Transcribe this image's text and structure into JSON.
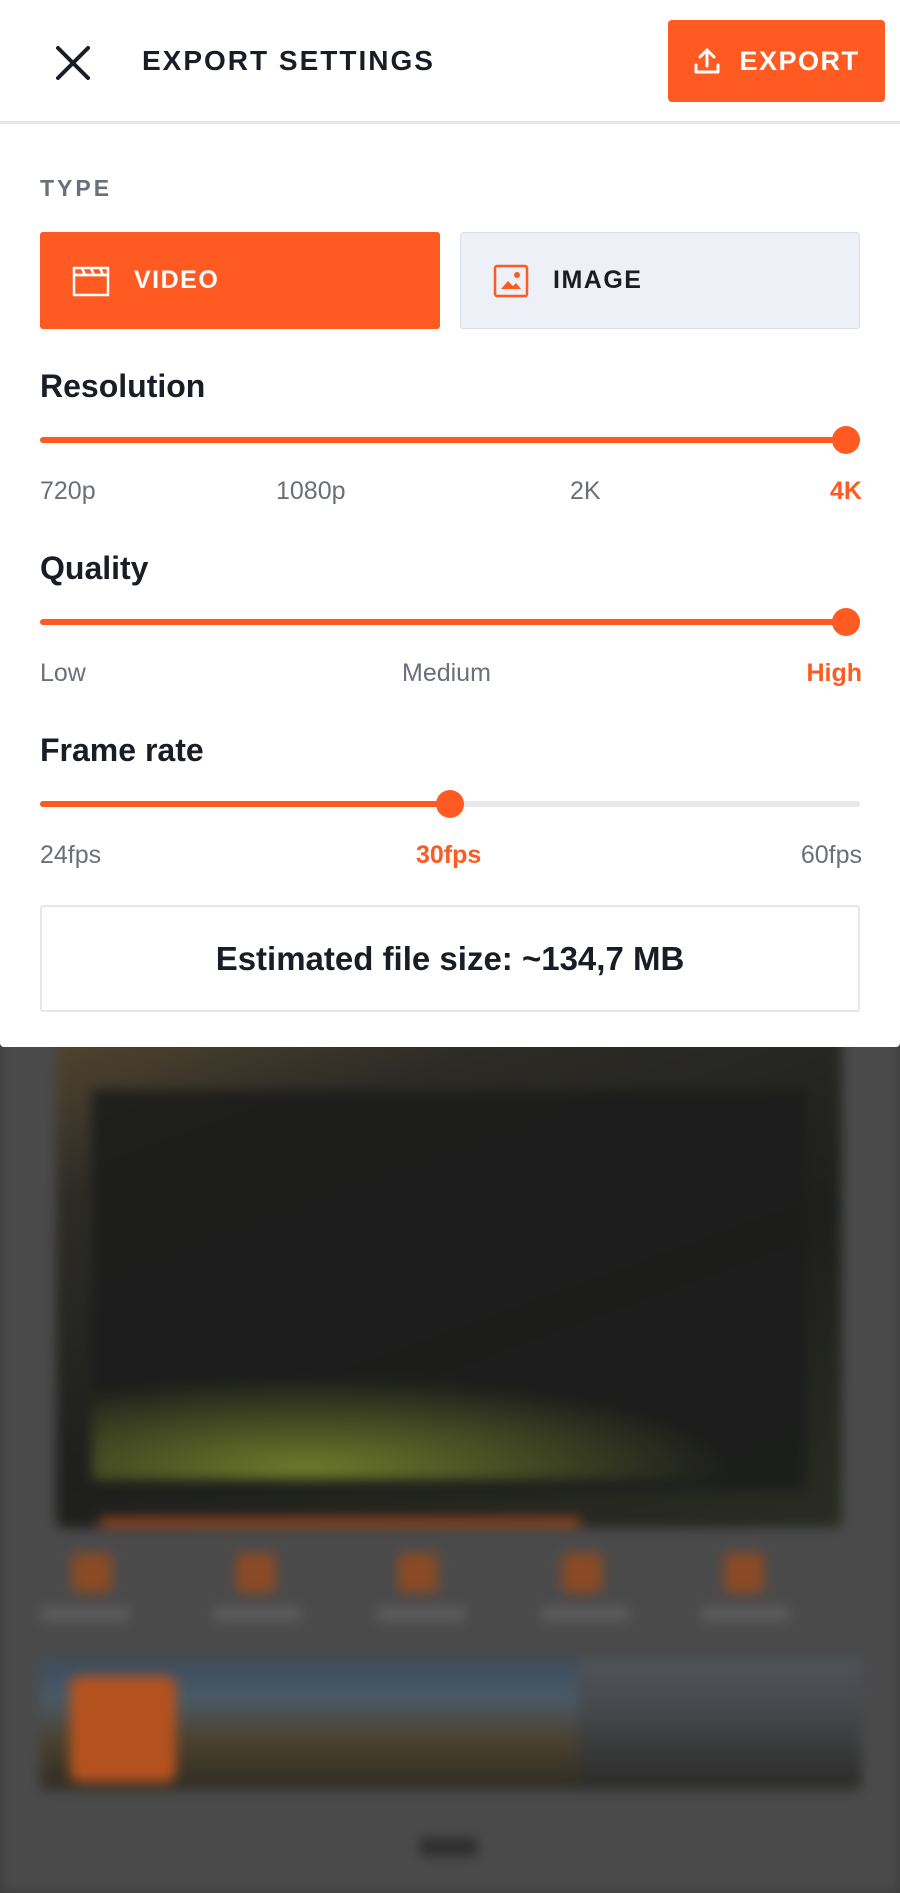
{
  "header": {
    "title": "EXPORT SETTINGS",
    "export_label": "EXPORT"
  },
  "type_section": {
    "label": "TYPE",
    "options": [
      {
        "label": "VIDEO",
        "icon": "clapperboard-icon",
        "selected": true
      },
      {
        "label": "IMAGE",
        "icon": "image-icon",
        "selected": false
      }
    ]
  },
  "resolution": {
    "title": "Resolution",
    "options": [
      "720p",
      "1080p",
      "2K",
      "4K"
    ],
    "selected": "4K",
    "value_fraction": 1.0
  },
  "quality": {
    "title": "Quality",
    "options": [
      "Low",
      "Medium",
      "High"
    ],
    "selected": "High",
    "value_fraction": 1.0
  },
  "frame_rate": {
    "title": "Frame rate",
    "options": [
      "24fps",
      "30fps",
      "60fps"
    ],
    "selected": "30fps",
    "value_fraction": 0.5
  },
  "estimate": {
    "text": "Estimated file size: ~134,7 MB"
  },
  "colors": {
    "accent": "#ff5a22",
    "text": "#1a1c26",
    "muted": "#6b6f7a",
    "track": "#e6e8ee"
  }
}
